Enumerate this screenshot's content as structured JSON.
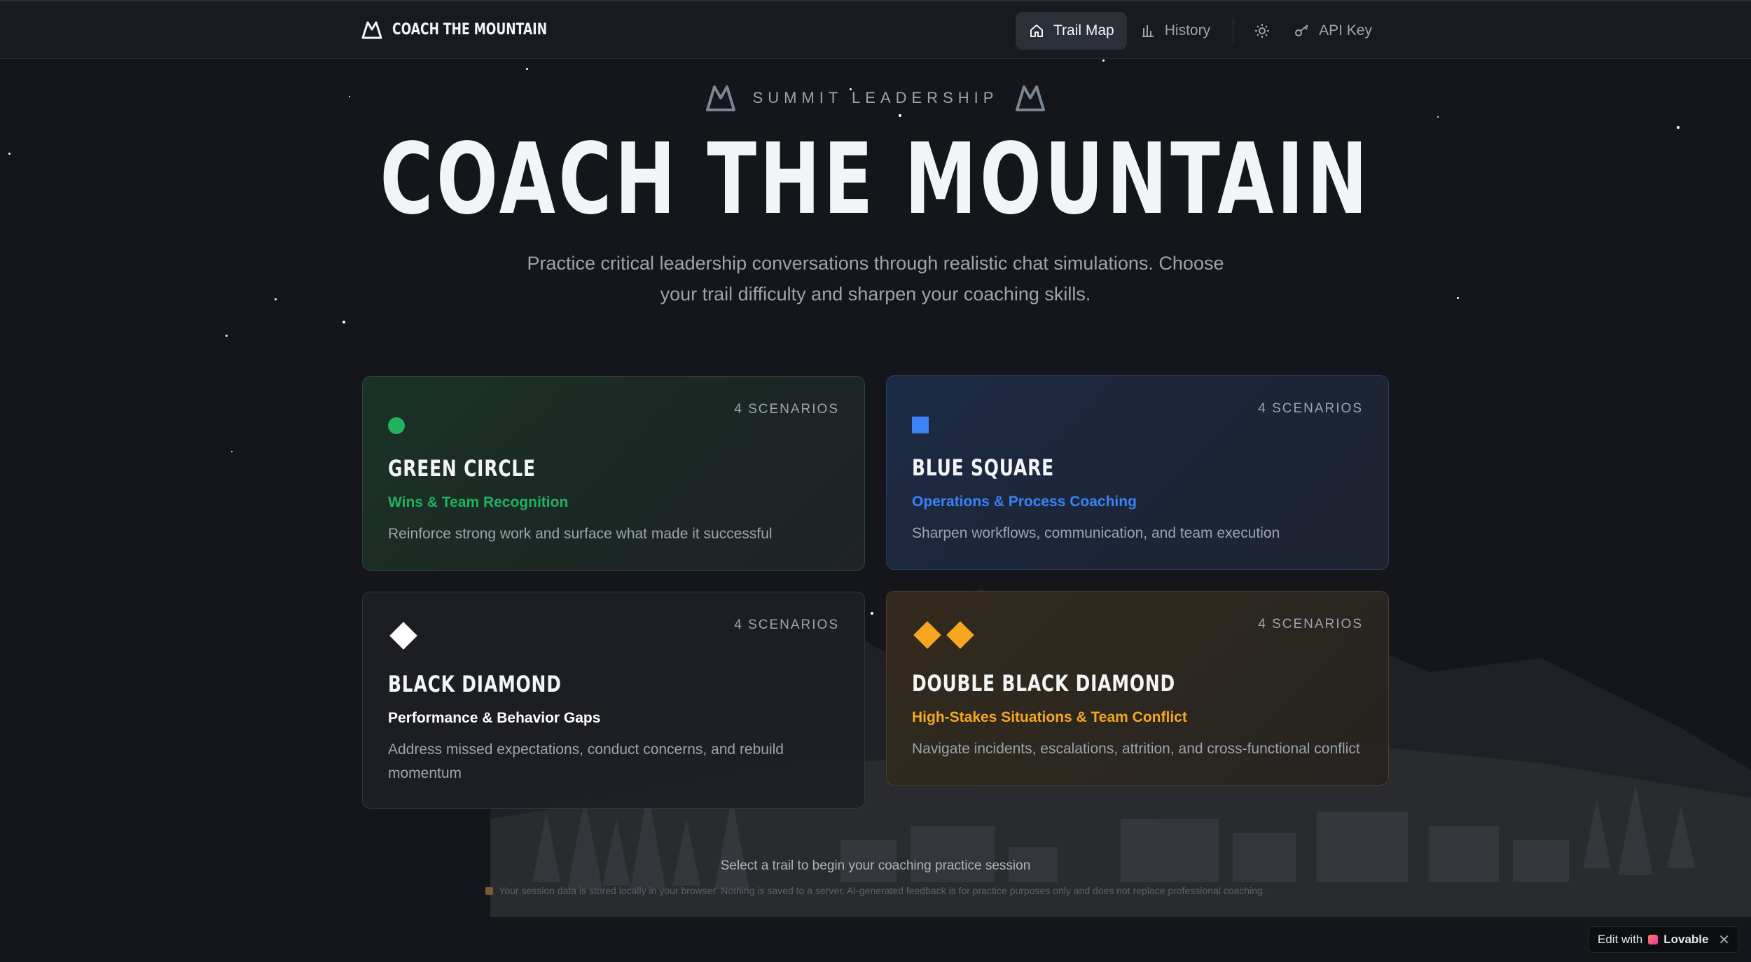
{
  "nav": {
    "brand": "COACH THE MOUNTAIN",
    "links": [
      {
        "label": "Trail Map",
        "icon": "home-icon",
        "active": true
      },
      {
        "label": "History",
        "icon": "bar-chart-icon",
        "active": false
      }
    ],
    "theme_icon": "sun-icon",
    "api_key": {
      "label": "API Key",
      "icon": "key-icon"
    }
  },
  "hero": {
    "eyebrow": "SUMMIT LEADERSHIP",
    "title": "COACH THE MOUNTAIN",
    "subtitle": "Practice critical leadership conversations through realistic chat simulations. Choose your trail difficulty and sharpen your coaching skills."
  },
  "trails": [
    {
      "count": "4 SCENARIOS",
      "title": "GREEN CIRCLE",
      "subtitle": "Wins & Team Recognition",
      "description": "Reinforce strong work and surface what made it successful",
      "icon": "green-circle-icon",
      "accent": "#22b15f"
    },
    {
      "count": "4 SCENARIOS",
      "title": "BLUE SQUARE",
      "subtitle": "Operations & Process Coaching",
      "description": "Sharpen workflows, communication, and team execution",
      "icon": "blue-square-icon",
      "accent": "#3b82f6"
    },
    {
      "count": "4 SCENARIOS",
      "title": "BLACK DIAMOND",
      "subtitle": "Performance & Behavior Gaps",
      "description": "Address missed expectations, conduct concerns, and rebuild momentum",
      "icon": "black-diamond-icon",
      "accent": "#ffffff"
    },
    {
      "count": "4 SCENARIOS",
      "title": "DOUBLE BLACK DIAMOND",
      "subtitle": "High-Stakes Situations & Team Conflict",
      "description": "Navigate incidents, escalations, attrition, and cross-functional conflict",
      "icon": "double-diamond-icon",
      "accent": "#f5a623"
    }
  ],
  "footer": {
    "hint": "Select a trail to begin your coaching practice session",
    "note": "Your session data is stored locally in your browser. Nothing is saved to a server. AI-generated feedback is for practice purposes only and does not replace professional coaching."
  },
  "badge": {
    "prefix": "Edit with",
    "brand": "Lovable",
    "close": "✕"
  }
}
